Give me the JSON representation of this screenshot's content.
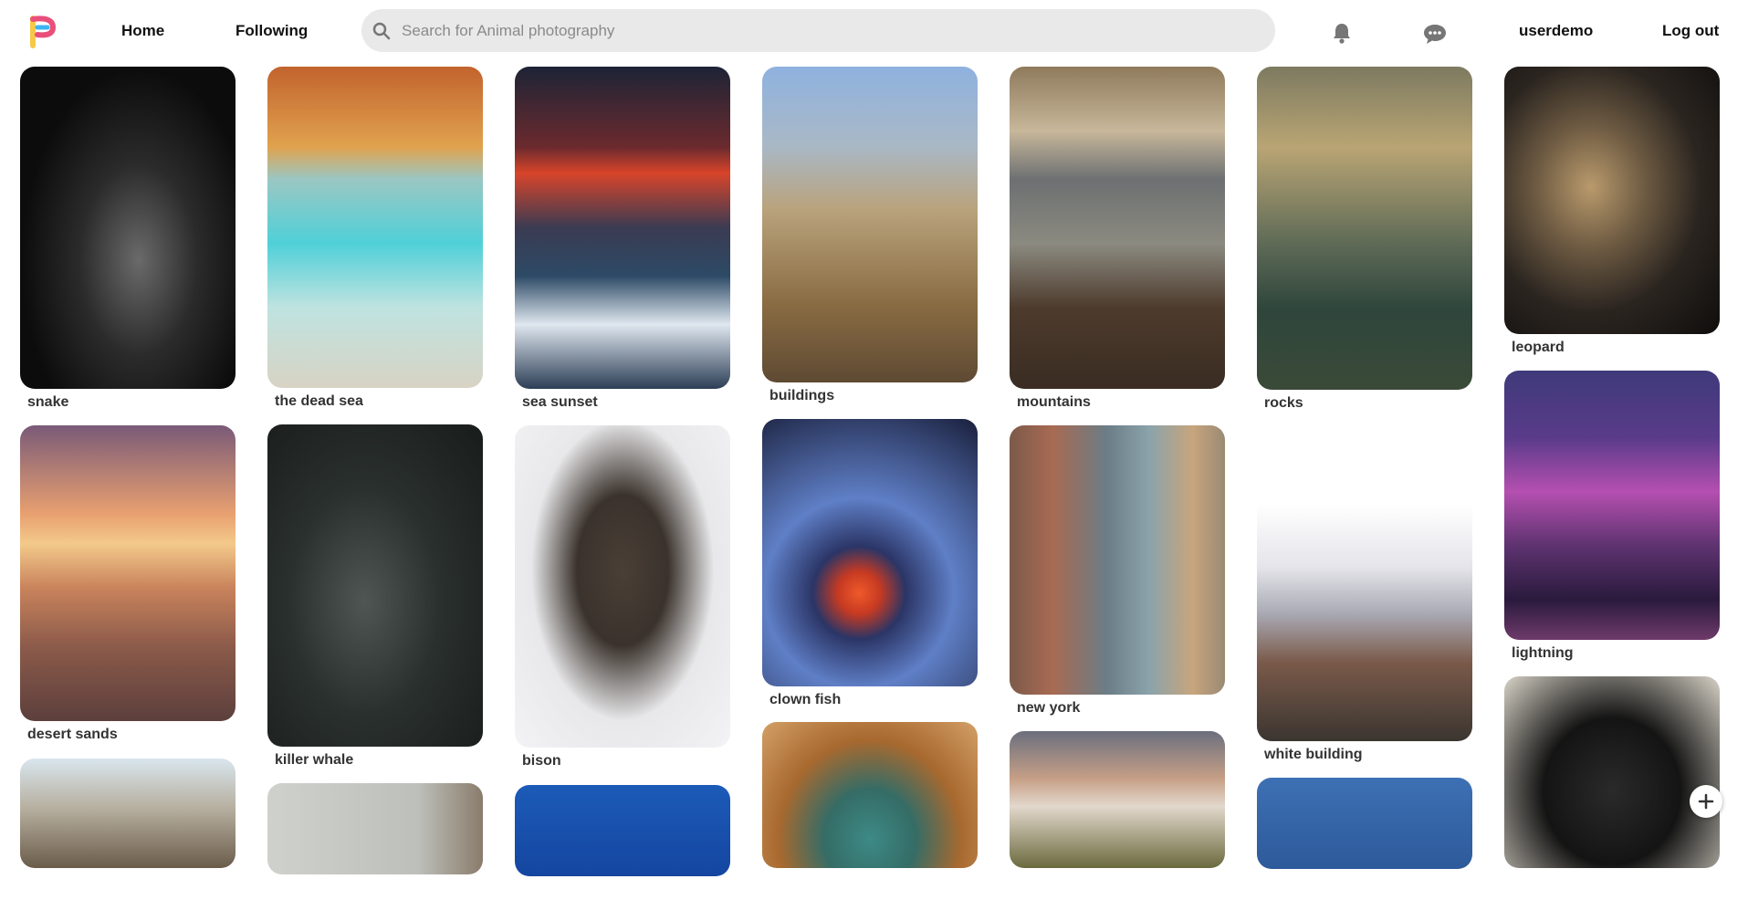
{
  "app": {
    "logo_letter": "P",
    "brand_colors": [
      "#f7c948",
      "#e94f7a",
      "#3db4f2"
    ]
  },
  "nav": {
    "home_label": "Home",
    "following_label": "Following",
    "username": "userdemo",
    "logout_label": "Log out"
  },
  "search": {
    "placeholder": "Search for Animal photography",
    "value": ""
  },
  "icons": [
    "search-icon",
    "bell-icon",
    "chat-icon",
    "plus-icon"
  ],
  "pins": [
    {
      "title": "snake"
    },
    {
      "title": "desert sands"
    },
    {
      "title": ""
    },
    {
      "title": "the dead sea"
    },
    {
      "title": "killer whale"
    },
    {
      "title": ""
    },
    {
      "title": "sea sunset"
    },
    {
      "title": "bison"
    },
    {
      "title": ""
    },
    {
      "title": "buildings"
    },
    {
      "title": "clown fish"
    },
    {
      "title": ""
    },
    {
      "title": "mountains"
    },
    {
      "title": "new york"
    },
    {
      "title": ""
    },
    {
      "title": "rocks"
    },
    {
      "title": "white building"
    },
    {
      "title": ""
    },
    {
      "title": "leopard"
    },
    {
      "title": "lightning"
    },
    {
      "title": ""
    }
  ]
}
